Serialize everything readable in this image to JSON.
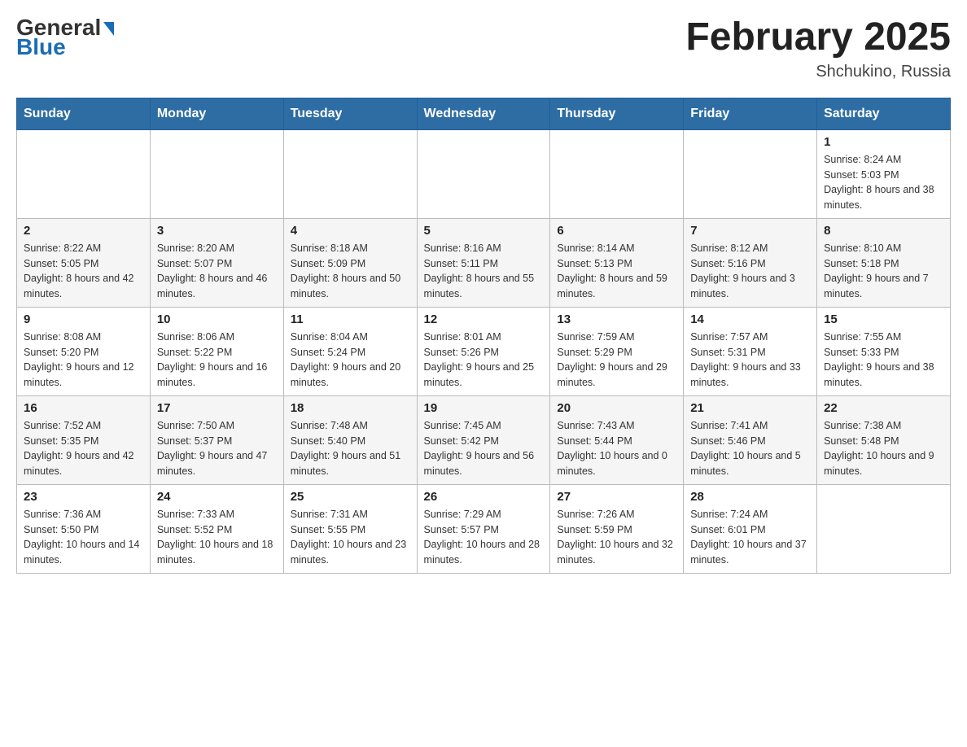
{
  "header": {
    "logo": {
      "text_general": "General",
      "text_blue": "Blue"
    },
    "title": "February 2025",
    "location": "Shchukino, Russia"
  },
  "days_of_week": [
    "Sunday",
    "Monday",
    "Tuesday",
    "Wednesday",
    "Thursday",
    "Friday",
    "Saturday"
  ],
  "weeks": [
    [
      {
        "day": "",
        "info": ""
      },
      {
        "day": "",
        "info": ""
      },
      {
        "day": "",
        "info": ""
      },
      {
        "day": "",
        "info": ""
      },
      {
        "day": "",
        "info": ""
      },
      {
        "day": "",
        "info": ""
      },
      {
        "day": "1",
        "info": "Sunrise: 8:24 AM\nSunset: 5:03 PM\nDaylight: 8 hours and 38 minutes."
      }
    ],
    [
      {
        "day": "2",
        "info": "Sunrise: 8:22 AM\nSunset: 5:05 PM\nDaylight: 8 hours and 42 minutes."
      },
      {
        "day": "3",
        "info": "Sunrise: 8:20 AM\nSunset: 5:07 PM\nDaylight: 8 hours and 46 minutes."
      },
      {
        "day": "4",
        "info": "Sunrise: 8:18 AM\nSunset: 5:09 PM\nDaylight: 8 hours and 50 minutes."
      },
      {
        "day": "5",
        "info": "Sunrise: 8:16 AM\nSunset: 5:11 PM\nDaylight: 8 hours and 55 minutes."
      },
      {
        "day": "6",
        "info": "Sunrise: 8:14 AM\nSunset: 5:13 PM\nDaylight: 8 hours and 59 minutes."
      },
      {
        "day": "7",
        "info": "Sunrise: 8:12 AM\nSunset: 5:16 PM\nDaylight: 9 hours and 3 minutes."
      },
      {
        "day": "8",
        "info": "Sunrise: 8:10 AM\nSunset: 5:18 PM\nDaylight: 9 hours and 7 minutes."
      }
    ],
    [
      {
        "day": "9",
        "info": "Sunrise: 8:08 AM\nSunset: 5:20 PM\nDaylight: 9 hours and 12 minutes."
      },
      {
        "day": "10",
        "info": "Sunrise: 8:06 AM\nSunset: 5:22 PM\nDaylight: 9 hours and 16 minutes."
      },
      {
        "day": "11",
        "info": "Sunrise: 8:04 AM\nSunset: 5:24 PM\nDaylight: 9 hours and 20 minutes."
      },
      {
        "day": "12",
        "info": "Sunrise: 8:01 AM\nSunset: 5:26 PM\nDaylight: 9 hours and 25 minutes."
      },
      {
        "day": "13",
        "info": "Sunrise: 7:59 AM\nSunset: 5:29 PM\nDaylight: 9 hours and 29 minutes."
      },
      {
        "day": "14",
        "info": "Sunrise: 7:57 AM\nSunset: 5:31 PM\nDaylight: 9 hours and 33 minutes."
      },
      {
        "day": "15",
        "info": "Sunrise: 7:55 AM\nSunset: 5:33 PM\nDaylight: 9 hours and 38 minutes."
      }
    ],
    [
      {
        "day": "16",
        "info": "Sunrise: 7:52 AM\nSunset: 5:35 PM\nDaylight: 9 hours and 42 minutes."
      },
      {
        "day": "17",
        "info": "Sunrise: 7:50 AM\nSunset: 5:37 PM\nDaylight: 9 hours and 47 minutes."
      },
      {
        "day": "18",
        "info": "Sunrise: 7:48 AM\nSunset: 5:40 PM\nDaylight: 9 hours and 51 minutes."
      },
      {
        "day": "19",
        "info": "Sunrise: 7:45 AM\nSunset: 5:42 PM\nDaylight: 9 hours and 56 minutes."
      },
      {
        "day": "20",
        "info": "Sunrise: 7:43 AM\nSunset: 5:44 PM\nDaylight: 10 hours and 0 minutes."
      },
      {
        "day": "21",
        "info": "Sunrise: 7:41 AM\nSunset: 5:46 PM\nDaylight: 10 hours and 5 minutes."
      },
      {
        "day": "22",
        "info": "Sunrise: 7:38 AM\nSunset: 5:48 PM\nDaylight: 10 hours and 9 minutes."
      }
    ],
    [
      {
        "day": "23",
        "info": "Sunrise: 7:36 AM\nSunset: 5:50 PM\nDaylight: 10 hours and 14 minutes."
      },
      {
        "day": "24",
        "info": "Sunrise: 7:33 AM\nSunset: 5:52 PM\nDaylight: 10 hours and 18 minutes."
      },
      {
        "day": "25",
        "info": "Sunrise: 7:31 AM\nSunset: 5:55 PM\nDaylight: 10 hours and 23 minutes."
      },
      {
        "day": "26",
        "info": "Sunrise: 7:29 AM\nSunset: 5:57 PM\nDaylight: 10 hours and 28 minutes."
      },
      {
        "day": "27",
        "info": "Sunrise: 7:26 AM\nSunset: 5:59 PM\nDaylight: 10 hours and 32 minutes."
      },
      {
        "day": "28",
        "info": "Sunrise: 7:24 AM\nSunset: 6:01 PM\nDaylight: 10 hours and 37 minutes."
      },
      {
        "day": "",
        "info": ""
      }
    ]
  ],
  "colors": {
    "header_bg": "#2d6da3",
    "header_text": "#ffffff",
    "accent_blue": "#1a6db5"
  }
}
